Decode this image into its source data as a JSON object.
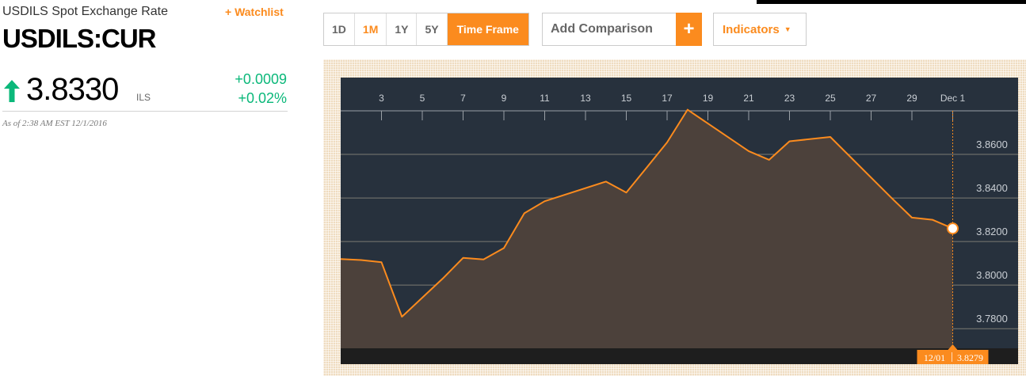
{
  "quote": {
    "subtitle": "USDILS Spot Exchange Rate",
    "watchlist_label": "+ Watchlist",
    "ticker": "USDILS:CUR",
    "price": "3.8330",
    "currency": "ILS",
    "change_abs": "+0.0009",
    "change_pct": "+0.02%",
    "as_of": "As of 2:38 AM EST 12/1/2016",
    "direction": "up"
  },
  "toolbar": {
    "ranges": [
      {
        "label": "1D",
        "active": false
      },
      {
        "label": "1M",
        "active": true
      },
      {
        "label": "1Y",
        "active": false
      },
      {
        "label": "5Y",
        "active": false
      }
    ],
    "timeframe_label": "Time Frame",
    "comparison_placeholder": "Add Comparison",
    "comparison_add": "+",
    "indicators_label": "Indicators"
  },
  "colors": {
    "accent": "#fb8b1e",
    "positive": "#0bb87a",
    "chart_bg": "#27313d",
    "area_fill": "#4c413b",
    "grid": "#7b7b73"
  },
  "chart_data": {
    "type": "area",
    "title": "",
    "xlabel": "",
    "ylabel": "",
    "x_ticks": [
      "3",
      "5",
      "7",
      "9",
      "11",
      "13",
      "15",
      "17",
      "19",
      "21",
      "23",
      "25",
      "27",
      "29",
      "Dec 1"
    ],
    "y_ticks": [
      "3.7800",
      "3.8000",
      "3.8200",
      "3.8400",
      "3.8600"
    ],
    "ylim": [
      3.771,
      3.88
    ],
    "grid": true,
    "legend": "none",
    "series": [
      {
        "x": [
          "2016-11-01",
          "2016-11-02",
          "2016-11-03",
          "2016-11-04",
          "2016-11-06",
          "2016-11-07",
          "2016-11-08",
          "2016-11-09",
          "2016-11-10",
          "2016-11-11",
          "2016-11-14",
          "2016-11-15",
          "2016-11-16",
          "2016-11-17",
          "2016-11-18",
          "2016-11-21",
          "2016-11-22",
          "2016-11-23",
          "2016-11-25",
          "2016-11-28",
          "2016-11-29",
          "2016-11-30",
          "2016-12-01"
        ],
        "y": [
          3.812,
          3.8115,
          3.8105,
          3.7855,
          3.803,
          3.8125,
          3.8118,
          3.817,
          3.833,
          3.8385,
          3.8475,
          3.8425,
          3.854,
          3.8655,
          3.8805,
          3.8615,
          3.8575,
          3.866,
          3.868,
          3.84,
          3.831,
          3.83,
          3.826
        ]
      }
    ],
    "crosshair": {
      "x": "2016-12-01",
      "date_label": "12/01",
      "value_label": "3.8279"
    }
  }
}
